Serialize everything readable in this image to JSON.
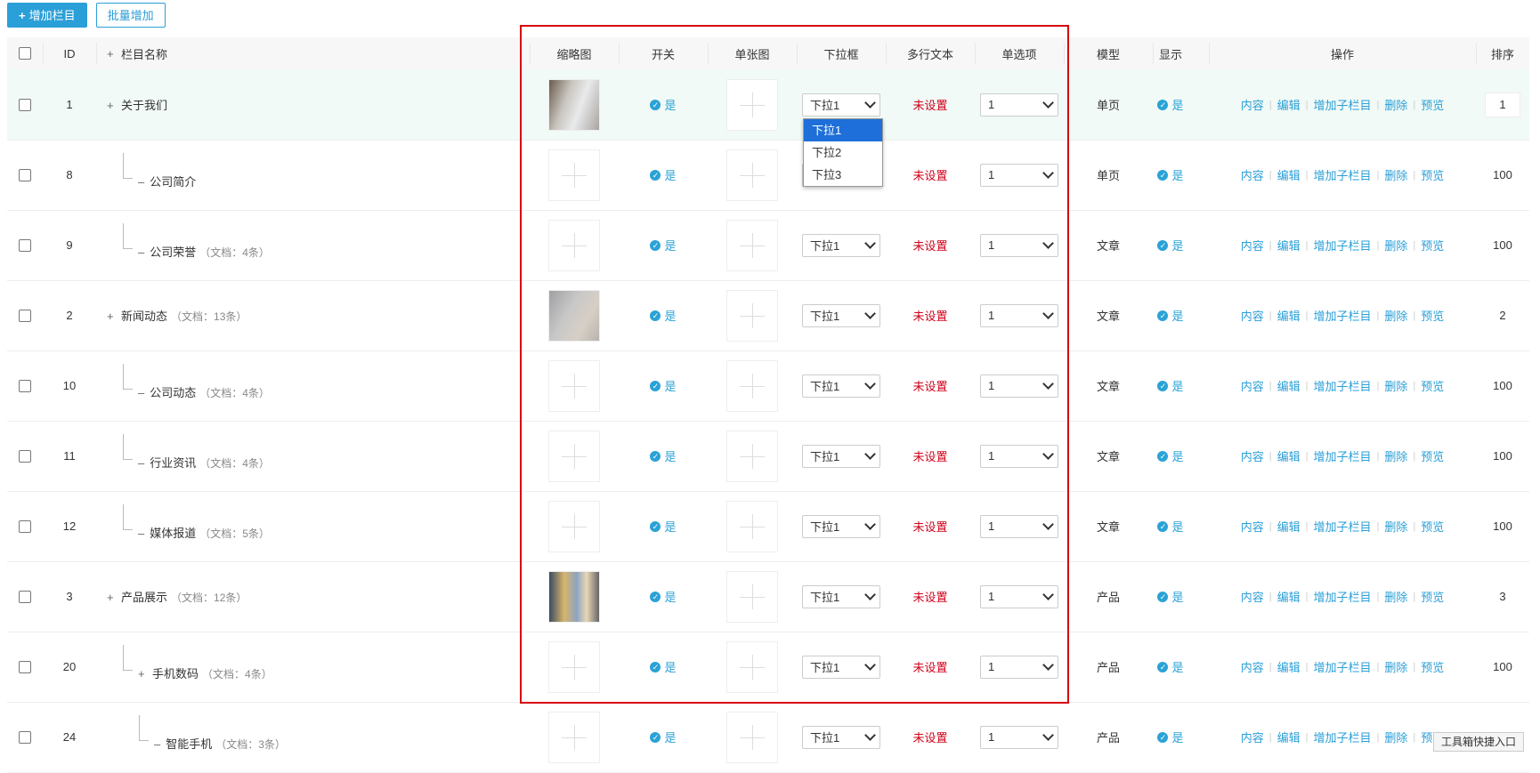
{
  "toolbar": {
    "add_label": "增加栏目",
    "batch_label": "批量增加"
  },
  "headers": {
    "id": "ID",
    "name": "栏目名称",
    "thumb": "缩略图",
    "switch": "开关",
    "single_image": "单张图",
    "dropdown": "下拉框",
    "multitext": "多行文本",
    "radio": "单选项",
    "model": "模型",
    "show": "显示",
    "ops": "操作",
    "sort": "排序"
  },
  "ops": {
    "content": "内容",
    "edit": "编辑",
    "add_child": "增加子栏目",
    "delete": "删除",
    "preview": "预览"
  },
  "yes_label": "是",
  "unset_label": "未设置",
  "rows": [
    {
      "id": "1",
      "name": "关于我们",
      "meta": "",
      "level": 0,
      "toggle": "+",
      "thumb": "img-a",
      "dropdown": "下拉1",
      "radio": "1",
      "model": "单页",
      "sort": "1"
    },
    {
      "id": "8",
      "name": "公司简介",
      "meta": "",
      "level": 1,
      "toggle": "–",
      "thumb": "empty",
      "dropdown": "下拉1",
      "radio": "1",
      "model": "单页",
      "sort": "100"
    },
    {
      "id": "9",
      "name": "公司荣誉",
      "meta": "（文档：4条）",
      "level": 1,
      "toggle": "–",
      "thumb": "empty",
      "dropdown": "下拉1",
      "radio": "1",
      "model": "文章",
      "sort": "100"
    },
    {
      "id": "2",
      "name": "新闻动态",
      "meta": "（文档：13条）",
      "level": 0,
      "toggle": "+",
      "thumb": "img-b",
      "dropdown": "下拉1",
      "radio": "1",
      "model": "文章",
      "sort": "2"
    },
    {
      "id": "10",
      "name": "公司动态",
      "meta": "（文档：4条）",
      "level": 1,
      "toggle": "–",
      "thumb": "empty",
      "dropdown": "下拉1",
      "radio": "1",
      "model": "文章",
      "sort": "100"
    },
    {
      "id": "11",
      "name": "行业资讯",
      "meta": "（文档：4条）",
      "level": 1,
      "toggle": "–",
      "thumb": "empty",
      "dropdown": "下拉1",
      "radio": "1",
      "model": "文章",
      "sort": "100"
    },
    {
      "id": "12",
      "name": "媒体报道",
      "meta": "（文档：5条）",
      "level": 1,
      "toggle": "–",
      "thumb": "empty",
      "dropdown": "下拉1",
      "radio": "1",
      "model": "文章",
      "sort": "100"
    },
    {
      "id": "3",
      "name": "产品展示",
      "meta": "（文档：12条）",
      "level": 0,
      "toggle": "+",
      "thumb": "img-c",
      "dropdown": "下拉1",
      "radio": "1",
      "model": "产品",
      "sort": "3"
    },
    {
      "id": "20",
      "name": "手机数码",
      "meta": "（文档：4条）",
      "level": 1,
      "toggle": "+",
      "thumb": "empty",
      "dropdown": "下拉1",
      "radio": "1",
      "model": "产品",
      "sort": "100"
    },
    {
      "id": "24",
      "name": "智能手机",
      "meta": "（文档：3条）",
      "level": 2,
      "toggle": "–",
      "thumb": "empty",
      "dropdown": "下拉1",
      "radio": "1",
      "model": "产品",
      "sort": ""
    }
  ],
  "dropdown_menu": {
    "options": [
      "下拉1",
      "下拉2",
      "下拉3"
    ],
    "selected": "下拉1"
  },
  "corner_tip": "工具箱快捷入口",
  "colors": {
    "primary": "#2b9fd7",
    "danger": "#d0021b",
    "highlight_box": "#d7000f"
  }
}
